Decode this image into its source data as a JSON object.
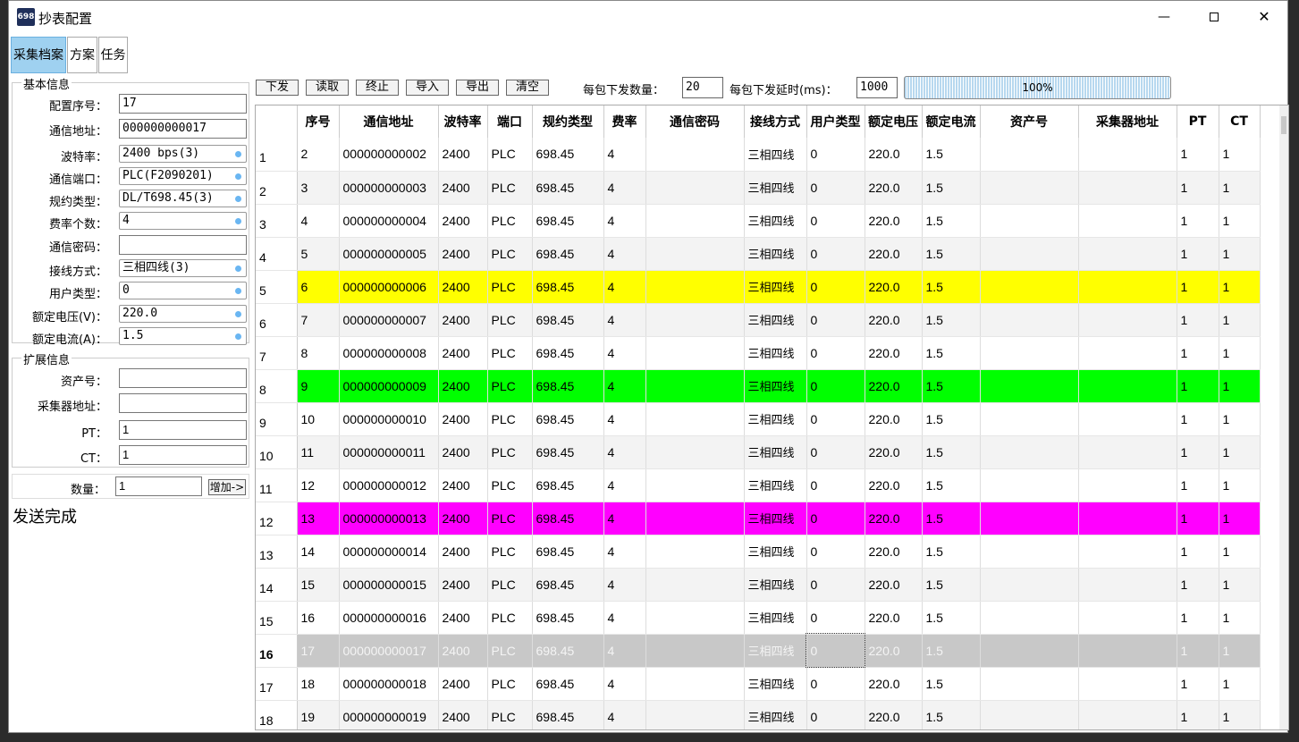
{
  "window": {
    "icon_text": "698",
    "title": "抄表配置"
  },
  "tabs": [
    {
      "label": "采集档案",
      "active": true
    },
    {
      "label": "方案",
      "active": false
    },
    {
      "label": "任务",
      "active": false
    }
  ],
  "basic": {
    "group_title": "基本信息",
    "fields": [
      {
        "label": "配置序号：",
        "value": "17",
        "kind": "input"
      },
      {
        "label": "通信地址：",
        "value": "000000000017",
        "kind": "input"
      },
      {
        "label": "波特率：",
        "value": "2400 bps(3)",
        "kind": "combo"
      },
      {
        "label": "通信端口：",
        "value": "PLC(F2090201)",
        "kind": "combo"
      },
      {
        "label": "规约类型：",
        "value": "DL/T698.45(3)",
        "kind": "combo"
      },
      {
        "label": "费率个数：",
        "value": "4",
        "kind": "combo"
      },
      {
        "label": "通信密码：",
        "value": "",
        "kind": "input"
      },
      {
        "label": "接线方式：",
        "value": "三相四线(3)",
        "kind": "combo"
      },
      {
        "label": "用户类型：",
        "value": "0",
        "kind": "combo"
      },
      {
        "label": "额定电压(V)：",
        "value": "220.0",
        "kind": "combo"
      },
      {
        "label": "额定电流(A)：",
        "value": "1.5",
        "kind": "combo"
      }
    ]
  },
  "ext": {
    "group_title": "扩展信息",
    "fields": [
      {
        "label": "资产号：",
        "value": ""
      },
      {
        "label": "采集器地址：",
        "value": ""
      },
      {
        "label": "PT：",
        "value": "1"
      },
      {
        "label": "CT：",
        "value": "1"
      }
    ]
  },
  "qty": {
    "label": "数量：",
    "value": "1",
    "button": "增加->"
  },
  "status_text": "发送完成",
  "toolbar": {
    "buttons": [
      "下发",
      "读取",
      "终止",
      "导入",
      "导出",
      "清空"
    ],
    "pkt_count_label": "每包下发数量：",
    "pkt_count_value": "20",
    "pkt_delay_label": "每包下发延时(ms)：",
    "pkt_delay_value": "1000",
    "progress_text": "100%",
    "progress_fraction": 1.0
  },
  "table": {
    "columns": [
      "",
      "序号",
      "通信地址",
      "波特率",
      "端口",
      "规约类型",
      "费率",
      "通信密码",
      "接线方式",
      "用户类型",
      "额定电压",
      "额定电流",
      "资产号",
      "采集器地址",
      "PT",
      "CT"
    ],
    "colors": {
      "yellow": "#ffff00",
      "green": "#00ff00",
      "magenta": "#ff00ff",
      "selected": "#c8c8c8",
      "alt": "#f3f3f3"
    },
    "rows": [
      {
        "rn": "1",
        "seq": "2",
        "addr": "000000000002",
        "baud": "2400",
        "port": "PLC",
        "proto": "698.45",
        "rate": "4",
        "pwd": "",
        "wiring": "三相四线",
        "utype": "0",
        "volt": "220.0",
        "curr": "1.5",
        "asset": "",
        "collector": "",
        "pt": "1",
        "ct": "1",
        "hl": ""
      },
      {
        "rn": "2",
        "seq": "3",
        "addr": "000000000003",
        "baud": "2400",
        "port": "PLC",
        "proto": "698.45",
        "rate": "4",
        "pwd": "",
        "wiring": "三相四线",
        "utype": "0",
        "volt": "220.0",
        "curr": "1.5",
        "asset": "",
        "collector": "",
        "pt": "1",
        "ct": "1",
        "hl": "alt"
      },
      {
        "rn": "3",
        "seq": "4",
        "addr": "000000000004",
        "baud": "2400",
        "port": "PLC",
        "proto": "698.45",
        "rate": "4",
        "pwd": "",
        "wiring": "三相四线",
        "utype": "0",
        "volt": "220.0",
        "curr": "1.5",
        "asset": "",
        "collector": "",
        "pt": "1",
        "ct": "1",
        "hl": ""
      },
      {
        "rn": "4",
        "seq": "5",
        "addr": "000000000005",
        "baud": "2400",
        "port": "PLC",
        "proto": "698.45",
        "rate": "4",
        "pwd": "",
        "wiring": "三相四线",
        "utype": "0",
        "volt": "220.0",
        "curr": "1.5",
        "asset": "",
        "collector": "",
        "pt": "1",
        "ct": "1",
        "hl": "alt"
      },
      {
        "rn": "5",
        "seq": "6",
        "addr": "000000000006",
        "baud": "2400",
        "port": "PLC",
        "proto": "698.45",
        "rate": "4",
        "pwd": "",
        "wiring": "三相四线",
        "utype": "0",
        "volt": "220.0",
        "curr": "1.5",
        "asset": "",
        "collector": "",
        "pt": "1",
        "ct": "1",
        "hl": "yellow"
      },
      {
        "rn": "6",
        "seq": "7",
        "addr": "000000000007",
        "baud": "2400",
        "port": "PLC",
        "proto": "698.45",
        "rate": "4",
        "pwd": "",
        "wiring": "三相四线",
        "utype": "0",
        "volt": "220.0",
        "curr": "1.5",
        "asset": "",
        "collector": "",
        "pt": "1",
        "ct": "1",
        "hl": "alt"
      },
      {
        "rn": "7",
        "seq": "8",
        "addr": "000000000008",
        "baud": "2400",
        "port": "PLC",
        "proto": "698.45",
        "rate": "4",
        "pwd": "",
        "wiring": "三相四线",
        "utype": "0",
        "volt": "220.0",
        "curr": "1.5",
        "asset": "",
        "collector": "",
        "pt": "1",
        "ct": "1",
        "hl": ""
      },
      {
        "rn": "8",
        "seq": "9",
        "addr": "000000000009",
        "baud": "2400",
        "port": "PLC",
        "proto": "698.45",
        "rate": "4",
        "pwd": "",
        "wiring": "三相四线",
        "utype": "0",
        "volt": "220.0",
        "curr": "1.5",
        "asset": "",
        "collector": "",
        "pt": "1",
        "ct": "1",
        "hl": "green"
      },
      {
        "rn": "9",
        "seq": "10",
        "addr": "000000000010",
        "baud": "2400",
        "port": "PLC",
        "proto": "698.45",
        "rate": "4",
        "pwd": "",
        "wiring": "三相四线",
        "utype": "0",
        "volt": "220.0",
        "curr": "1.5",
        "asset": "",
        "collector": "",
        "pt": "1",
        "ct": "1",
        "hl": ""
      },
      {
        "rn": "10",
        "seq": "11",
        "addr": "000000000011",
        "baud": "2400",
        "port": "PLC",
        "proto": "698.45",
        "rate": "4",
        "pwd": "",
        "wiring": "三相四线",
        "utype": "0",
        "volt": "220.0",
        "curr": "1.5",
        "asset": "",
        "collector": "",
        "pt": "1",
        "ct": "1",
        "hl": "alt"
      },
      {
        "rn": "11",
        "seq": "12",
        "addr": "000000000012",
        "baud": "2400",
        "port": "PLC",
        "proto": "698.45",
        "rate": "4",
        "pwd": "",
        "wiring": "三相四线",
        "utype": "0",
        "volt": "220.0",
        "curr": "1.5",
        "asset": "",
        "collector": "",
        "pt": "1",
        "ct": "1",
        "hl": ""
      },
      {
        "rn": "12",
        "seq": "13",
        "addr": "000000000013",
        "baud": "2400",
        "port": "PLC",
        "proto": "698.45",
        "rate": "4",
        "pwd": "",
        "wiring": "三相四线",
        "utype": "0",
        "volt": "220.0",
        "curr": "1.5",
        "asset": "",
        "collector": "",
        "pt": "1",
        "ct": "1",
        "hl": "magenta"
      },
      {
        "rn": "13",
        "seq": "14",
        "addr": "000000000014",
        "baud": "2400",
        "port": "PLC",
        "proto": "698.45",
        "rate": "4",
        "pwd": "",
        "wiring": "三相四线",
        "utype": "0",
        "volt": "220.0",
        "curr": "1.5",
        "asset": "",
        "collector": "",
        "pt": "1",
        "ct": "1",
        "hl": ""
      },
      {
        "rn": "14",
        "seq": "15",
        "addr": "000000000015",
        "baud": "2400",
        "port": "PLC",
        "proto": "698.45",
        "rate": "4",
        "pwd": "",
        "wiring": "三相四线",
        "utype": "0",
        "volt": "220.0",
        "curr": "1.5",
        "asset": "",
        "collector": "",
        "pt": "1",
        "ct": "1",
        "hl": "alt"
      },
      {
        "rn": "15",
        "seq": "16",
        "addr": "000000000016",
        "baud": "2400",
        "port": "PLC",
        "proto": "698.45",
        "rate": "4",
        "pwd": "",
        "wiring": "三相四线",
        "utype": "0",
        "volt": "220.0",
        "curr": "1.5",
        "asset": "",
        "collector": "",
        "pt": "1",
        "ct": "1",
        "hl": ""
      },
      {
        "rn": "16",
        "seq": "17",
        "addr": "000000000017",
        "baud": "2400",
        "port": "PLC",
        "proto": "698.45",
        "rate": "4",
        "pwd": "",
        "wiring": "三相四线",
        "utype": "0",
        "volt": "220.0",
        "curr": "1.5",
        "asset": "",
        "collector": "",
        "pt": "1",
        "ct": "1",
        "hl": "selected"
      },
      {
        "rn": "17",
        "seq": "18",
        "addr": "000000000018",
        "baud": "2400",
        "port": "PLC",
        "proto": "698.45",
        "rate": "4",
        "pwd": "",
        "wiring": "三相四线",
        "utype": "0",
        "volt": "220.0",
        "curr": "1.5",
        "asset": "",
        "collector": "",
        "pt": "1",
        "ct": "1",
        "hl": ""
      },
      {
        "rn": "18",
        "seq": "19",
        "addr": "000000000019",
        "baud": "2400",
        "port": "PLC",
        "proto": "698.45",
        "rate": "4",
        "pwd": "",
        "wiring": "三相四线",
        "utype": "0",
        "volt": "220.0",
        "curr": "1.5",
        "asset": "",
        "collector": "",
        "pt": "1",
        "ct": "1",
        "hl": "alt"
      }
    ]
  }
}
